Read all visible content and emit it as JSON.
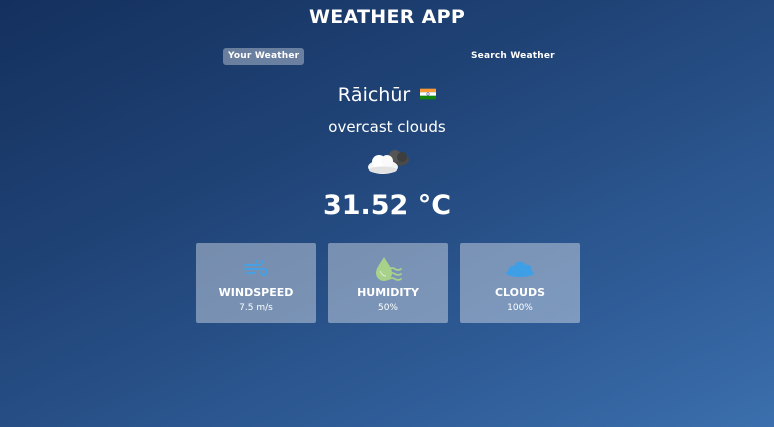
{
  "header": {
    "title": "WEATHER APP"
  },
  "tabs": [
    {
      "label": "Your Weather",
      "active": true
    },
    {
      "label": "Search Weather",
      "active": false
    }
  ],
  "location": {
    "city": "Rāichūr",
    "country_flag": "india-flag-icon"
  },
  "weather": {
    "description": "overcast clouds",
    "icon": "overcast-clouds-icon",
    "temperature": "31.52 °C"
  },
  "cards": [
    {
      "label": "WINDSPEED",
      "value": "7.5 m/s",
      "icon": "wind-icon"
    },
    {
      "label": "HUMIDITY",
      "value": "50%",
      "icon": "humidity-icon"
    },
    {
      "label": "CLOUDS",
      "value": "100%",
      "icon": "clouds-icon"
    }
  ],
  "colors": {
    "background_top": "#14305e",
    "background_bottom": "#3b6fad",
    "wind_icon": "#3fa3e8",
    "humidity_icon": "#a8d18a",
    "clouds_icon": "#3f9fe6"
  }
}
